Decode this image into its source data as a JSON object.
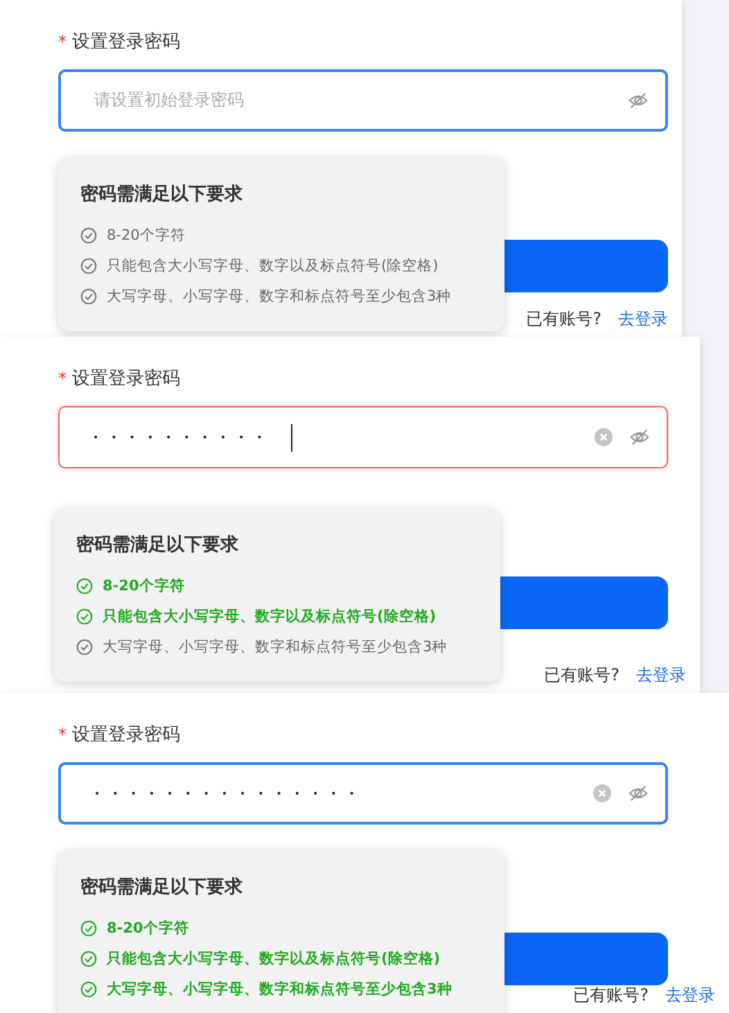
{
  "panels": [
    {
      "label": "设置登录密码",
      "required_mark": "*",
      "input": {
        "placeholder": "请设置初始登录密码",
        "error": false,
        "clearable": false,
        "caret": false
      },
      "popover": {
        "title": "密码需满足以下要求",
        "rules": [
          {
            "text": "8-20个字符",
            "met": false
          },
          {
            "text": "只能包含大小写字母、数字以及标点符号(除空格)",
            "met": false
          },
          {
            "text": "大写字母、小写字母、数字和标点符号至少包含3种",
            "met": false
          }
        ]
      },
      "footer": {
        "text": "已有账号?",
        "link": "去登录"
      }
    },
    {
      "label": "设置登录密码",
      "required_mark": "*",
      "input": {
        "value": "••••••••••",
        "error": true,
        "clearable": true,
        "caret": true
      },
      "popover": {
        "title": "密码需满足以下要求",
        "rules": [
          {
            "text": "8-20个字符",
            "met": true
          },
          {
            "text": "只能包含大小写字母、数字以及标点符号(除空格)",
            "met": true
          },
          {
            "text": "大写字母、小写字母、数字和标点符号至少包含3种",
            "met": false
          }
        ]
      },
      "footer": {
        "text": "已有账号?",
        "link": "去登录"
      }
    },
    {
      "label": "设置登录密码",
      "required_mark": "*",
      "input": {
        "value": "•••••••••••••••",
        "error": false,
        "clearable": true,
        "caret": false
      },
      "popover": {
        "title": "密码需满足以下要求",
        "rules": [
          {
            "text": "8-20个字符",
            "met": true
          },
          {
            "text": "只能包含大小写字母、数字以及标点符号(除空格)",
            "met": true
          },
          {
            "text": "大写字母、小写字母、数字和标点符号至少包含3种",
            "met": true
          }
        ]
      },
      "footer": {
        "text": "已有账号?",
        "link": "去登录"
      }
    }
  ]
}
